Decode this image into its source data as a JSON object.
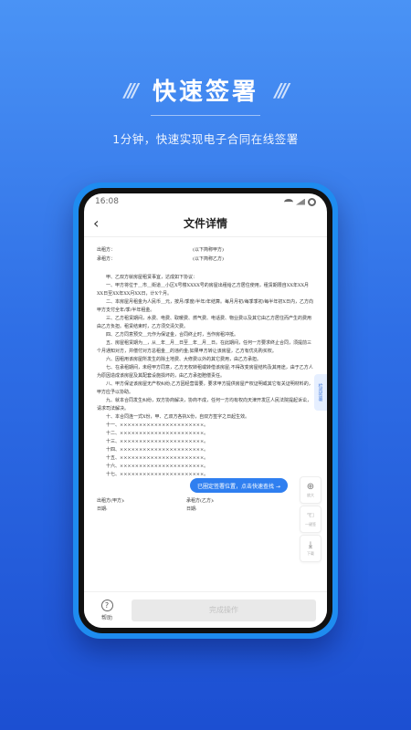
{
  "hero": {
    "slashes_left": "///",
    "slashes_right": "///",
    "title": "快速签署",
    "subtitle": "1分钟，快速实现电子合同在线签署"
  },
  "phone": {
    "status_time": "16:08",
    "nav_title": "文件详情",
    "back_icon": "‹"
  },
  "document": {
    "party_a_label": "出租方：",
    "party_a_value": "(以下简称甲方)",
    "party_b_label": "承租方：",
    "party_b_value": "(以下简称乙方)",
    "paragraphs": [
      "甲、乙双方就房屋租赁事宜，达成如下协议：",
      "一、甲方将位于＿市＿街道＿小区X号楼XXXX号的房屋出租给乙方居住使用，租赁期限自XX年XX月XX日至XX年XX月XX日，计X个月。",
      "二、本房屋月租金为人民币＿元，按月/季度/半年/年结算。每月月初/每季季初/每半年初X日内，乙方向甲方支付全年/季/半年租金。",
      "三、乙方租赁期间，水费、电费、取暖费、燃气费、电话费、物业费以及其它由乙方居住而产生的费用由乙方负担。租赁结束时，乙方须交清欠费。",
      "四、乙方同意预交＿元作为保证金，合同终止时，当作房租冲抵。",
      "五、房屋租赁期为＿，从＿年＿月＿日至＿年＿月＿日。在此期间，任何一方要求终止合同，须提前三个月通知对方，并偿付对方总租金＿的违约金;如果甲方转让该房屋，乙方有优先购买权。",
      "六、因租用该房屋所发生的除土地费、大修费以外的其它费用，由乙方承担。",
      "七、在承租期间，未经甲方同意，乙方无权转租或转借该房屋;不得改变房屋结构及其用途，由于乙方人为原因造成该房屋及其配套设施损坏的，由乙方承担赔偿责任。",
      "八、甲方保证该房屋无产权纠纷;乙方因经营需要，要求甲方提供房屋产权证明或其它有关证明材料的，甲方应予以协助。",
      "九、就本合同发生纠纷，双方协商解决，协商不成，任何一方均有权向天津开发区人民法院提起诉讼，请求司法解决。",
      "十、本合同连一式X份，甲、乙双方各执X份，自双方签字之日起生效。"
    ],
    "extra_lines": [
      "十一、××××××××××××××××××××××。",
      "十二、××××××××××××××××××××××。",
      "十三、××××××××××××××××××××××。",
      "十四、××××××××××××××××××××××。",
      "十五、××××××××××××××××××××××。",
      "十六、××××××××××××××××××××××。",
      "十七、××××××××××××××××××××××。"
    ],
    "sign_a": "出租方(甲方):",
    "sign_b": "承租方(乙方):",
    "date_a": "日期:",
    "date_b": "日期:"
  },
  "hint": "已圈定签署位置，点击快速查找 →",
  "side_tab": "检阅签署",
  "tools": [
    {
      "icon": "⊕",
      "label": "放大"
    },
    {
      "icon": "☜",
      "label": "一键签"
    },
    {
      "icon": "⤓",
      "label": "下载"
    }
  ],
  "bottom": {
    "help_icon": "?",
    "help_label": "帮助",
    "complete_label": "完成操作"
  }
}
